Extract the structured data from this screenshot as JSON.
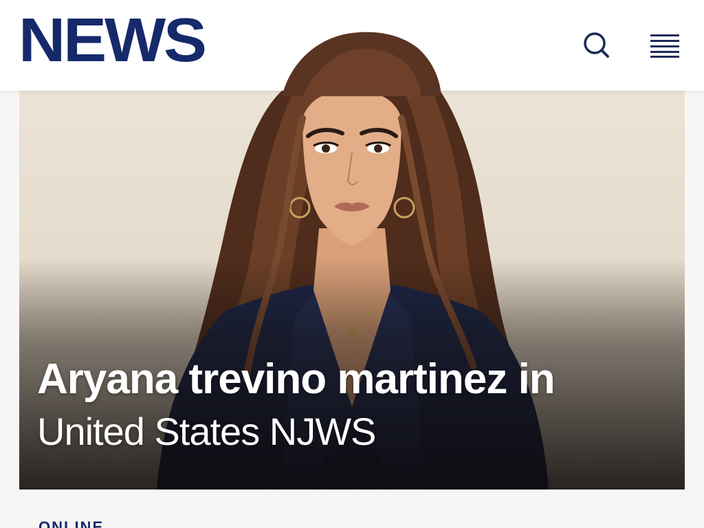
{
  "header": {
    "logo_text": "NEWS",
    "brand_color": "#162a6b",
    "search_icon": "search-icon",
    "menu_icon": "hamburger-menu-icon"
  },
  "hero": {
    "headline_line1": "Aryana trevino martinez in",
    "headline_line2": "United States NJWS",
    "image": "portrait-illustration"
  },
  "section": {
    "label": "ONLINE"
  },
  "colors": {
    "header_bg": "#ffffff",
    "page_bg": "#f7f6f4",
    "headline_text": "#ffffff",
    "jacket": "#1b2547",
    "hair": "#5a3422"
  }
}
